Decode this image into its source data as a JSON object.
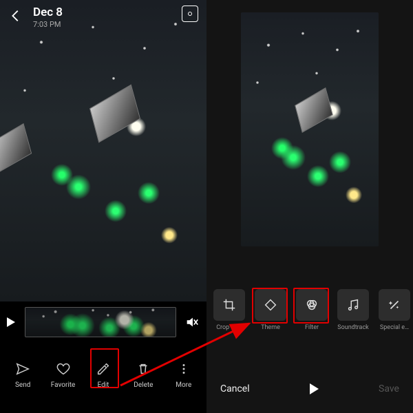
{
  "viewer": {
    "date": "Dec 8",
    "time": "7:03 PM",
    "actions": {
      "send": "Send",
      "favorite": "Favorite",
      "edit": "Edit",
      "delete": "Delete",
      "more": "More"
    }
  },
  "editor": {
    "tools": {
      "crop": "Crop & r…",
      "theme": "Theme",
      "filter": "Filter",
      "soundtrack": "Soundtrack",
      "special": "Special e…"
    },
    "footer": {
      "cancel": "Cancel",
      "save": "Save"
    }
  },
  "colors": {
    "highlight": "#e20000"
  }
}
